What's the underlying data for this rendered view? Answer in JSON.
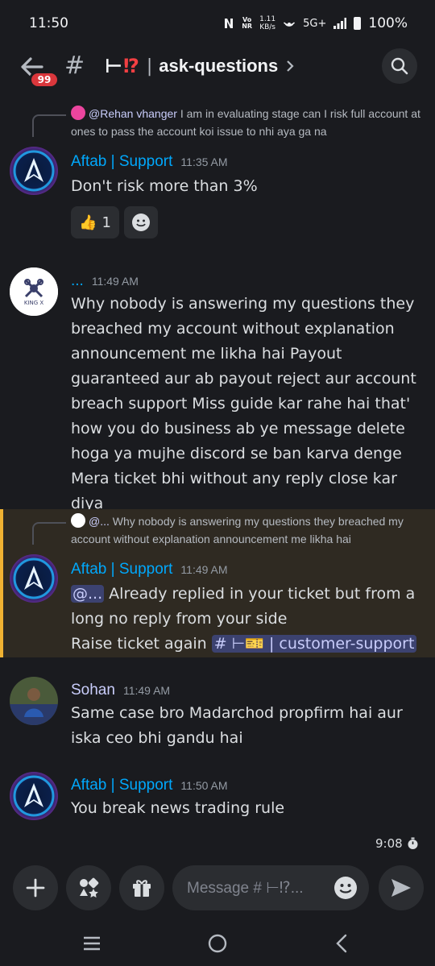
{
  "status_bar": {
    "time": "11:50",
    "net_speed_value": "1.11",
    "net_speed_unit": "KB/s",
    "vo_top": "Vo",
    "vo_bottom": "NR",
    "network": "5G+",
    "battery": "100%"
  },
  "header": {
    "unread_badge": "99",
    "channel_emoji": "⊢⁉",
    "separator": "|",
    "channel_name": "ask-questions"
  },
  "messages": [
    {
      "reply_author": "@Rehan vhanger",
      "reply_text": "I am in evaluating stage can I risk full account at ones to pass the account koi issue to nhi aya ga na",
      "author": "Aftab | Support",
      "author_color": "#00a8fc",
      "time": "11:35 AM",
      "text": "Don't risk more than 3%",
      "reactions": [
        {
          "emoji": "👍",
          "count": "1"
        }
      ]
    },
    {
      "author": "...",
      "author_color": "#00a8fc",
      "time": "11:49 AM",
      "avatar_label": "KING X",
      "text": "Why nobody is answering my questions they breached my account without explanation announcement me likha hai Payout guaranteed aur ab payout reject aur account breach support Miss guide kar rahe hai that' how you do business ab ye message delete hoga ya mujhe discord se ban karva denge Mera ticket bhi without any reply close kar diya"
    },
    {
      "reply_author": "@...",
      "reply_text": "Why nobody is answering my questions they breached my account without explanation announcement me likha hai",
      "author": "Aftab | Support",
      "author_color": "#00a8fc",
      "time": "11:49 AM",
      "mention": "@...",
      "text_line1": "Already replied in your ticket but from a long no reply from your side",
      "text_line2": "Raise ticket again",
      "channel_mention": "# ⊢🎫 | customer-support"
    },
    {
      "author": "Sohan",
      "author_color": "#c9cdfb",
      "time": "11:49 AM",
      "text": "Same case bro Madarchod propfirm hai aur iska ceo bhi gandu hai"
    },
    {
      "author": "Aftab | Support",
      "author_color": "#00a8fc",
      "time": "11:50 AM",
      "text": "You break news trading rule"
    }
  ],
  "slowmode_timer": "9:08",
  "composer": {
    "placeholder": "Message # ⊢⁉..."
  },
  "icons": {
    "back": "arrow-left-icon",
    "search": "search-icon",
    "add": "plus-icon",
    "apps": "apps-icon",
    "gift": "gift-icon",
    "emoji": "emoji-icon",
    "send": "send-icon",
    "timer": "stopwatch-icon"
  }
}
